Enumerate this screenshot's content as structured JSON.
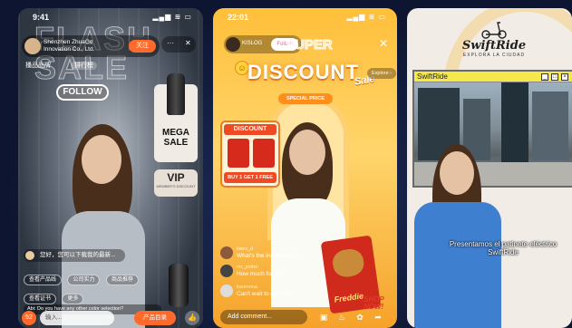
{
  "phone1": {
    "time": "9:41",
    "status_icons": "▂▄▆ ≋ ▭",
    "flash_text": "FLASH SALE",
    "host_name": "Shenzhen ZhuaGe Innovation Co., Ltd.",
    "follow_small": "关注",
    "menu_dots": "···",
    "close": "✕",
    "subtitle_left": "播品品牌",
    "subtitle_right": "排行榜",
    "follow_big": "FOLLOW",
    "mega_sale": "MEGA SALE",
    "vip": "VIP",
    "vip_sub": "MEMBER'S DISCOUNT",
    "comment": "您好，您可以下载我的最新...",
    "chips": [
      "查看产品线",
      "公司实力",
      "商品推荐",
      "查看证书",
      "更多"
    ],
    "english_comment": "Abi: Do you have any other color selection?",
    "badge_count": "52",
    "input_placeholder": "输入...",
    "shop_button": "产品目录",
    "like_icon": "👍"
  },
  "phone2": {
    "time": "22:01",
    "status_icons": "▂▄▆ ≋ ▭",
    "host_name": "KISLOG",
    "follow": "Follow",
    "close": "✕",
    "super_text": "SUPER",
    "discount": "DISCOUNT",
    "sale": "Sale",
    "special_price": "SPECIAL PRICE",
    "explore": "Explore ›",
    "promo_title": "DISCOUNT",
    "promo_footer": "BUY 1 GET 1 FREE",
    "comments": [
      {
        "user": "kiero_d",
        "text": "What's the ingredients?"
      },
      {
        "user": "mr_potter",
        "text": "How much for this?"
      },
      {
        "user": "karennna",
        "text": "Can't wait to get one!"
      }
    ],
    "brand": "Freddie",
    "shop_now": "SHOP NOW!",
    "input_placeholder": "Add comment...",
    "colors": {
      "accent": "#ffbf3a",
      "brand_red": "#cf2a1c"
    }
  },
  "phone3": {
    "brand": "SwiftRide",
    "tagline": "EXPLORA LA CIUDAD",
    "window_title": "SwiftRide",
    "subtitle": "Presentamos el patinete eléctrico SwiftRide"
  }
}
